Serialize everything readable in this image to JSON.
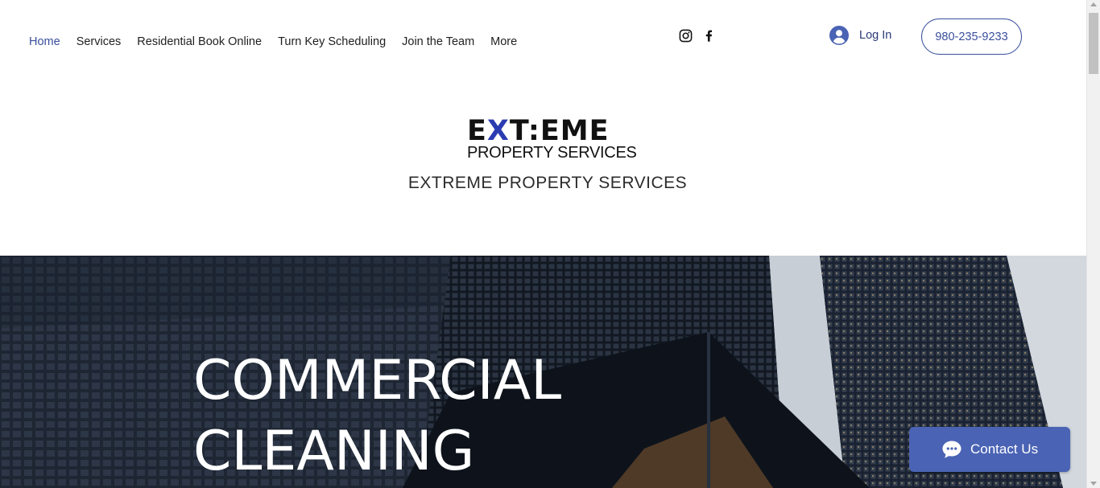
{
  "nav": {
    "items": [
      {
        "label": "Home",
        "active": true
      },
      {
        "label": "Services"
      },
      {
        "label": "Residential Book Online"
      },
      {
        "label": "Turn Key Scheduling"
      },
      {
        "label": "Join the Team"
      },
      {
        "label": "More"
      }
    ]
  },
  "social": {
    "icons": [
      "instagram-icon",
      "facebook-icon"
    ]
  },
  "login": {
    "label": "Log In",
    "icon": "user-avatar-icon"
  },
  "phone": {
    "label": "980-235-9233"
  },
  "logo": {
    "line1_pre": "E",
    "line1_x": "X",
    "line1_post": "T:EME",
    "line2": "PROPERTY SERVICES"
  },
  "site_title": "EXTREME PROPERTY SERVICES",
  "hero": {
    "line1": "COMMERCIAL",
    "line2": "CLEANING"
  },
  "contact": {
    "label": "Contact Us",
    "icon": "chat-bubble-icon"
  },
  "colors": {
    "accent": "#3a4f9c",
    "contact_bg": "#4a63b4",
    "logo_x": "#2b3bb0"
  }
}
